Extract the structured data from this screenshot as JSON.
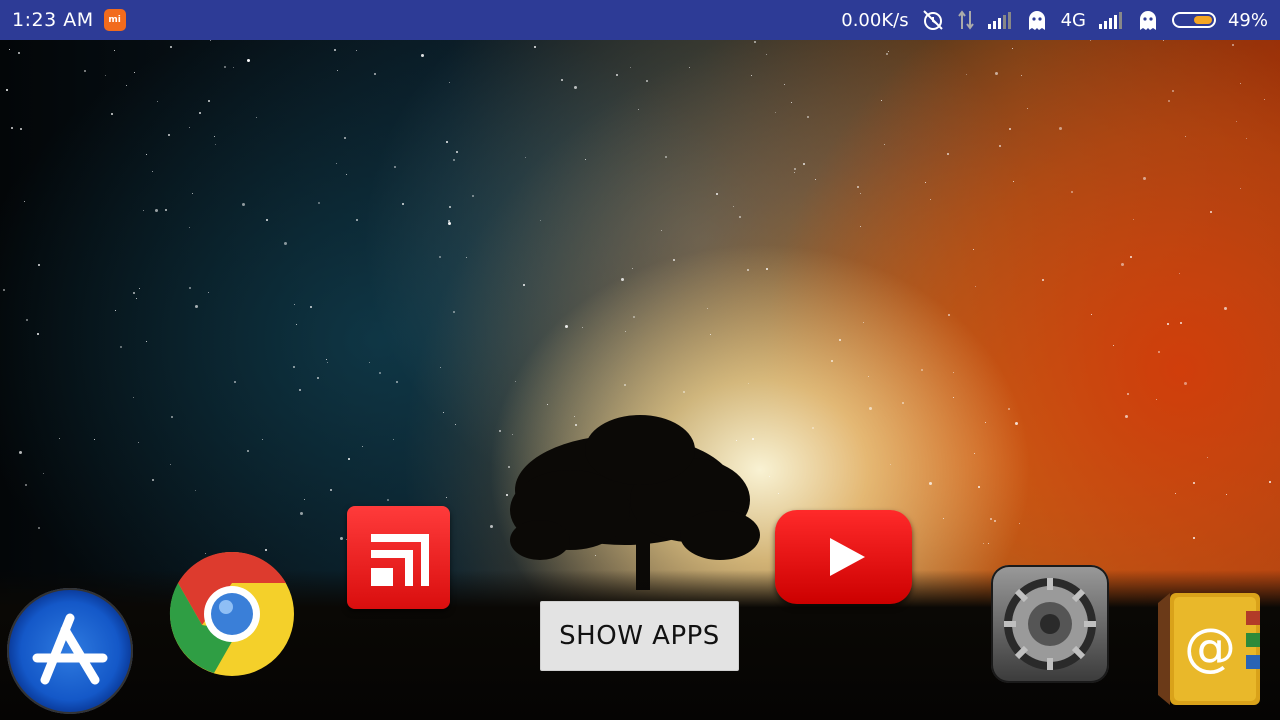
{
  "status_bar": {
    "time": "1:23 AM",
    "mi_badge": "mi",
    "net_speed": "0.00K/s",
    "network_type": "4G",
    "battery_percent": "49%",
    "battery_level": 0.49,
    "icons": [
      "mi-notification-icon",
      "alarm-off-icon",
      "data-transfer-icon",
      "signal-icon",
      "ghost-icon",
      "signal-icon",
      "ghost-icon",
      "battery-icon"
    ]
  },
  "home": {
    "show_apps_label": "SHOW APPS",
    "apps": [
      {
        "name": "App Store"
      },
      {
        "name": "Chrome"
      },
      {
        "name": "Flipboard"
      },
      {
        "name": "YouTube"
      },
      {
        "name": "Settings"
      },
      {
        "name": "Contacts"
      }
    ]
  },
  "colors": {
    "status_bar": "#2d3b96",
    "battery_fill": "#f5a623",
    "youtube_red": "#e00000",
    "button_bg": "#e3e3e3"
  }
}
